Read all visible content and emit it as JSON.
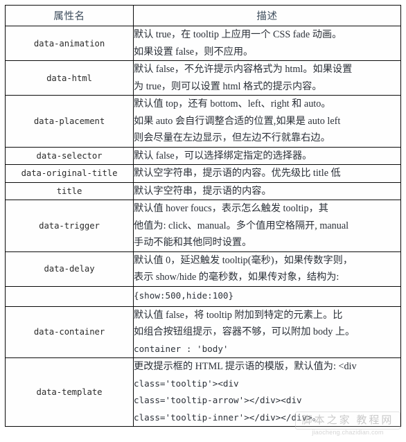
{
  "table": {
    "headers": {
      "name": "属性名",
      "description": "描述"
    },
    "rows": [
      {
        "name": "data-animation",
        "lines": [
          {
            "text": "默认 true，在 tooltip 上应用一个 CSS fade 动画。",
            "mono": false
          },
          {
            "text": "如果设置 false，则不应用。",
            "mono": false
          }
        ]
      },
      {
        "name": "data-html",
        "lines": [
          {
            "text": "默认 false，不允许提示内容格式为 html。如果设置",
            "mono": false
          },
          {
            "text": "为 true，则可以设置 html 格式的提示内容。",
            "mono": false
          }
        ]
      },
      {
        "name": "data-placement",
        "lines": [
          {
            "text": "默认值 top，还有 bottom、left、right 和 auto。",
            "mono": false
          },
          {
            "text": "如果 auto 会自行调整合适的位置,如果是 auto left",
            "mono": false
          },
          {
            "text": "则会尽量在左边显示，但左边不行就靠右边。",
            "mono": false
          }
        ]
      },
      {
        "name": "data-selector",
        "lines": [
          {
            "text": "默认 false，可以选择绑定指定的选择器。",
            "mono": false
          }
        ]
      },
      {
        "name": "data-original-title",
        "lines": [
          {
            "text": "默认空字符串，提示语的内容。优先级比 title 低",
            "mono": false
          }
        ]
      },
      {
        "name": "title",
        "lines": [
          {
            "text": "默认字空符串，提示语的内容。",
            "mono": false
          }
        ]
      },
      {
        "name": "data-trigger",
        "lines": [
          {
            "text": "默认值 hover foucs，表示怎么触发 tooltip，其",
            "mono": false
          },
          {
            "text": "他值为: click、manual。多个值用空格隔开, manual",
            "mono": false
          },
          {
            "text": "手动不能和其他同时设置。",
            "mono": false
          }
        ]
      },
      {
        "name": "data-delay",
        "lines": [
          {
            "text": "默认值 0，延迟触发 tooltip(毫秒)，如果传数字则，",
            "mono": false
          },
          {
            "text": "表示 show/hide 的毫秒数，如果传对象，结构为:",
            "mono": false
          }
        ]
      },
      {
        "name": "",
        "lines": [
          {
            "text": "{show:500,hide:100}",
            "mono": true
          }
        ]
      },
      {
        "name": "data-container",
        "lines": [
          {
            "text": "默认值 false，将 tooltip 附加到特定的元素上。比",
            "mono": false
          },
          {
            "text": "如组合按钮组提示，容器不够，可以附加 body 上。",
            "mono": false
          },
          {
            "text": "container : 'body'",
            "mono": true
          }
        ]
      },
      {
        "name": "data-template",
        "lines": [
          {
            "text": "更改提示框的 HTML 提示语的模版，默认值为: <div",
            "mono": false
          },
          {
            "text": "class='tooltip'><div",
            "mono": true
          },
          {
            "text": "class='tooltip-arrow'></div><div",
            "mono": true
          },
          {
            "text": "class='tooltip-inner'></div></div>。",
            "mono": true
          }
        ]
      }
    ]
  },
  "watermark": {
    "cn_text": "脚本之家 教程网",
    "url_text": "jiaocheng.chazidian.com"
  },
  "colors": {
    "border": "#0a0a0a",
    "header_text": "#3b4a5a",
    "body_text": "#2b3038",
    "background": "#ffffff",
    "watermark_text": "#9a9a9a"
  }
}
